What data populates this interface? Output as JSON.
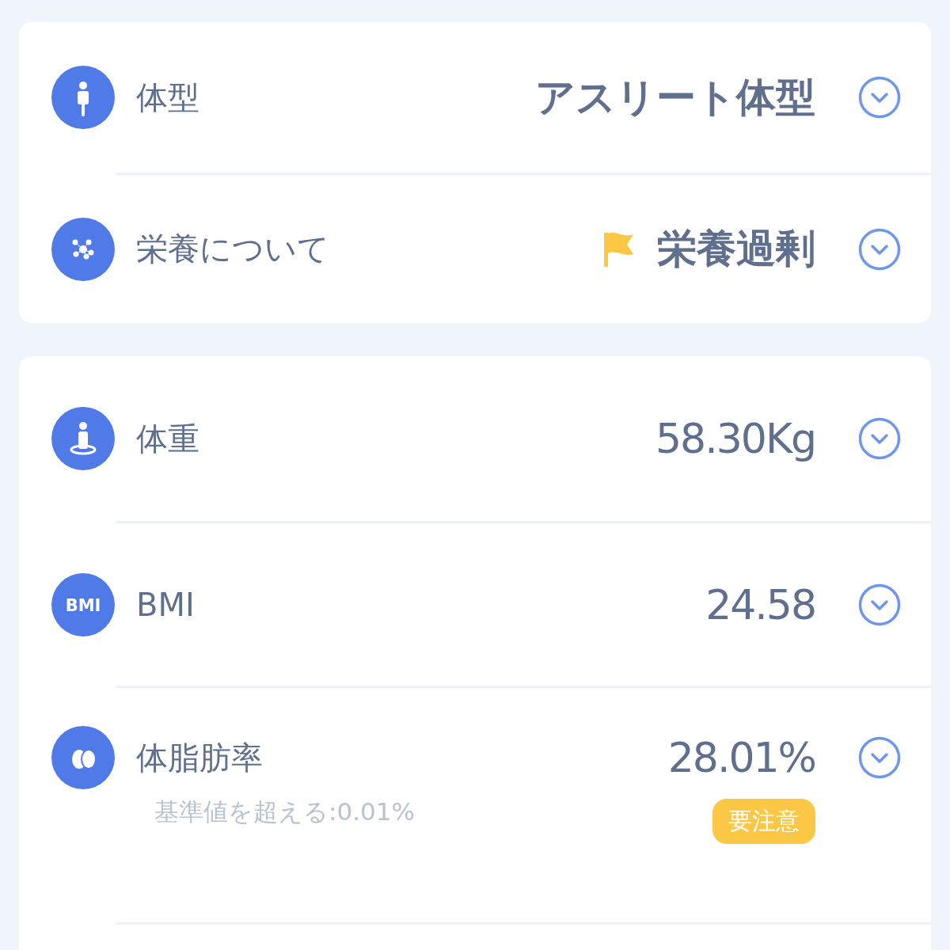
{
  "cards": [
    {
      "rows": [
        {
          "kind": "body",
          "label": "体型",
          "value": "アスリート体型",
          "flag": false
        },
        {
          "kind": "nutrition",
          "label": "栄養について",
          "value": "栄養過剰",
          "flag": true
        }
      ]
    },
    {
      "rows": [
        {
          "kind": "weight",
          "label": "体重",
          "value": "58.30Kg",
          "flag": false
        },
        {
          "kind": "bmi",
          "icon_text": "BMI",
          "label": "BMI",
          "value": "24.58",
          "flag": false
        },
        {
          "kind": "fat",
          "label": "体脂肪率",
          "value": "28.01%",
          "flag": false,
          "badge": "要注意",
          "note": "基準値を超える:0.01%"
        }
      ]
    }
  ]
}
